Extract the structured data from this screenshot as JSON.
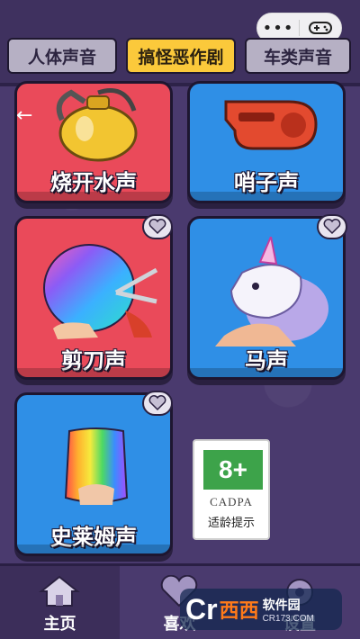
{
  "tabs": [
    {
      "label": "人体声音",
      "active": false
    },
    {
      "label": "搞怪恶作剧",
      "active": true
    },
    {
      "label": "车类声音",
      "active": false
    }
  ],
  "back_icon": "arrow-left-icon",
  "cards": [
    {
      "label": "烧开水声",
      "color": "#ea4a5a",
      "icon": "kettle-icon"
    },
    {
      "label": "哨子声",
      "color": "#2f8fe6",
      "icon": "whistle-icon"
    },
    {
      "label": "剪刀声",
      "color": "#ea4a5a",
      "icon": "scissors-icon",
      "favorite": true
    },
    {
      "label": "马声",
      "color": "#2f8fe6",
      "icon": "unicorn-icon",
      "favorite": true
    },
    {
      "label": "史莱姆声",
      "color": "#2f8fe6",
      "icon": "slime-icon",
      "favorite": true
    }
  ],
  "cadpa": {
    "age": "8+",
    "org": "CADPA",
    "tip": "适龄提示"
  },
  "bottom_nav": [
    {
      "label": "主页",
      "icon": "home-icon",
      "active": true
    },
    {
      "label": "喜欢",
      "icon": "heart-icon",
      "active": false
    },
    {
      "label": "设置",
      "icon": "gear-icon",
      "active": false
    }
  ],
  "watermark": {
    "brand_c": "Cr",
    "brand_cn": "西西",
    "text": "软件园",
    "url": "CR173.COM"
  }
}
